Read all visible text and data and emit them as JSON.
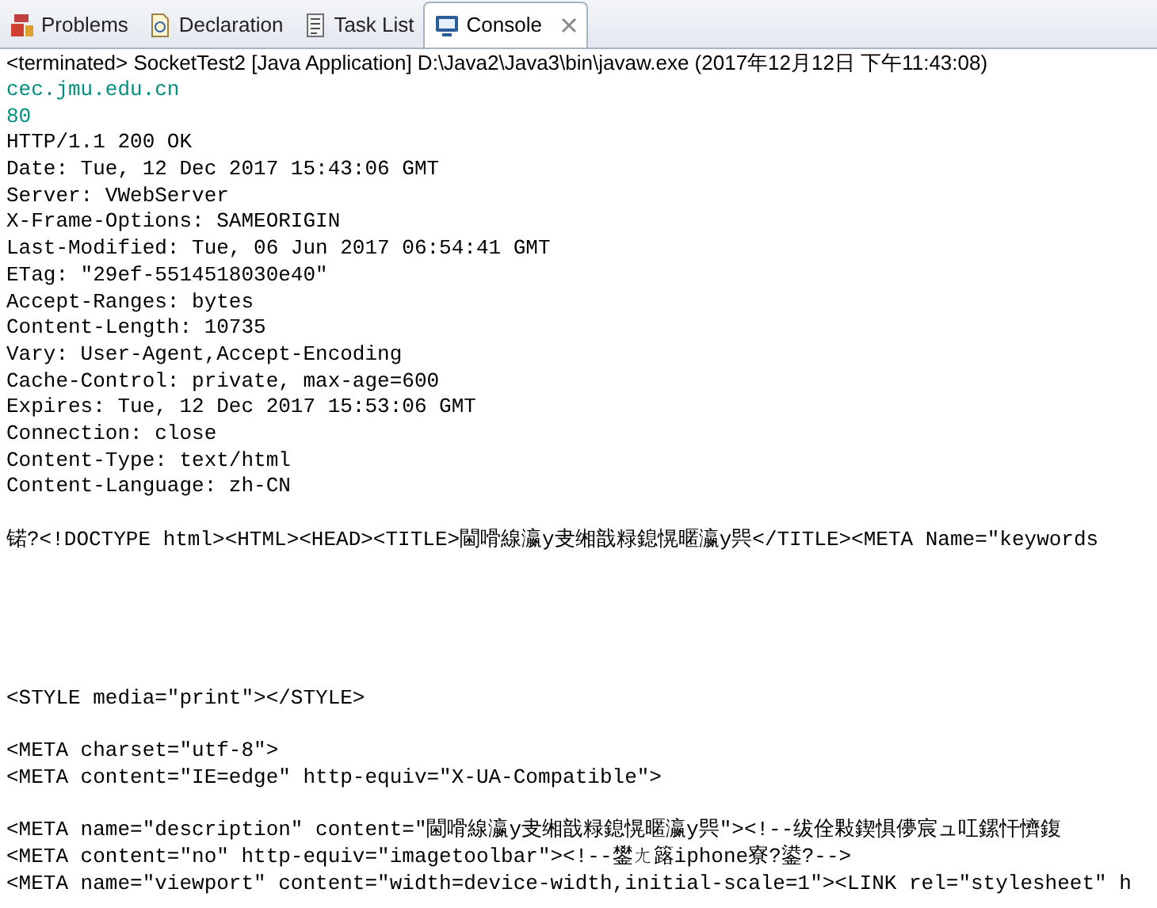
{
  "tabs": [
    {
      "label": "Problems",
      "kind": "problems",
      "selected": false
    },
    {
      "label": "Declaration",
      "kind": "declaration",
      "selected": false
    },
    {
      "label": "Task List",
      "kind": "tasks",
      "selected": false
    },
    {
      "label": "Console",
      "kind": "console",
      "selected": true,
      "closable": true
    }
  ],
  "console": {
    "status": "<terminated> SocketTest2 [Java Application] D:\\Java2\\Java3\\bin\\javaw.exe (2017年12月12日 下午11:43:08)",
    "lines": [
      {
        "kind": "input",
        "text": "cec.jmu.edu.cn"
      },
      {
        "kind": "input",
        "text": "80"
      },
      {
        "kind": "output",
        "text": "HTTP/1.1 200 OK"
      },
      {
        "kind": "output",
        "text": "Date: Tue, 12 Dec 2017 15:43:06 GMT"
      },
      {
        "kind": "output",
        "text": "Server: VWebServer"
      },
      {
        "kind": "output",
        "text": "X-Frame-Options: SAMEORIGIN"
      },
      {
        "kind": "output",
        "text": "Last-Modified: Tue, 06 Jun 2017 06:54:41 GMT"
      },
      {
        "kind": "output",
        "text": "ETag: \"29ef-5514518030e40\""
      },
      {
        "kind": "output",
        "text": "Accept-Ranges: bytes"
      },
      {
        "kind": "output",
        "text": "Content-Length: 10735"
      },
      {
        "kind": "output",
        "text": "Vary: User-Agent,Accept-Encoding"
      },
      {
        "kind": "output",
        "text": "Cache-Control: private, max-age=600"
      },
      {
        "kind": "output",
        "text": "Expires: Tue, 12 Dec 2017 15:53:06 GMT"
      },
      {
        "kind": "output",
        "text": "Connection: close"
      },
      {
        "kind": "output",
        "text": "Content-Type: text/html"
      },
      {
        "kind": "output",
        "text": "Content-Language: zh-CN"
      },
      {
        "kind": "blank"
      },
      {
        "kind": "output",
        "text": "锘?<!DOCTYPE html><HTML><HEAD><TITLE>閫嗗線瀛y叏缃戠粶鎴愰暱瀛y巺</TITLE><META Name=\"keywords"
      },
      {
        "kind": "blank"
      },
      {
        "kind": "blank"
      },
      {
        "kind": "blank"
      },
      {
        "kind": "blank"
      },
      {
        "kind": "blank"
      },
      {
        "kind": "output",
        "text": "<STYLE media=\"print\"></STYLE>"
      },
      {
        "kind": "blank"
      },
      {
        "kind": "output",
        "text": "<META charset=\"utf-8\">"
      },
      {
        "kind": "output",
        "text": "<META content=\"IE=edge\" http-equiv=\"X-UA-Compatible\">"
      },
      {
        "kind": "blank"
      },
      {
        "kind": "output",
        "text": "<META name=\"description\" content=\"閫嗗線瀛y叏缃戠粶鎴愰暱瀛y巺\"><!--绂佺敤鍥惧儚宸ュ叿鏍忓懠鍑"
      },
      {
        "kind": "output",
        "text": "<META content=\"no\" http-equiv=\"imagetoolbar\"><!--鐢ㄤ簬iphone寮?鍙?-->"
      },
      {
        "kind": "output",
        "text": "<META name=\"viewport\" content=\"width=device-width,initial-scale=1\"><LINK rel=\"stylesheet\" h"
      }
    ]
  }
}
